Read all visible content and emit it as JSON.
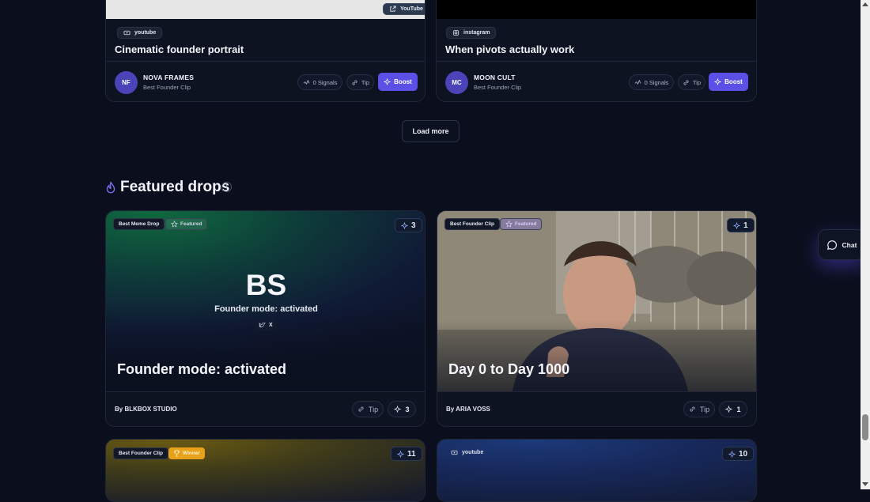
{
  "top_cards": [
    {
      "media_badge": "YouTube",
      "platform": "youtube",
      "title": "Cinematic founder portrait",
      "initials": "NF",
      "creator": "NOVA FRAMES",
      "category": "Best Founder Clip",
      "signals": "0 Signals",
      "tip": "Tip",
      "boost": "Boost"
    },
    {
      "platform": "instagram",
      "title": "When pivots actually work",
      "initials": "MC",
      "creator": "MOON CULT",
      "category": "Best Founder Clip",
      "signals": "0 Signals",
      "tip": "Tip",
      "boost": "Boost"
    }
  ],
  "load_more": "Load more",
  "section": {
    "title": "Featured drops",
    "info": "i"
  },
  "featured": [
    {
      "category": "Best Meme Drop",
      "featured": "Featured",
      "count": "3",
      "big_initials": "BS",
      "caption": "Founder mode: activated",
      "network": "X",
      "title": "Founder mode: activated",
      "by_prefix": "By",
      "author": "BLKBOX STUDIO",
      "tip": "Tip",
      "boost_count": "3"
    },
    {
      "category": "Best Founder Clip",
      "featured": "Featured",
      "count": "1",
      "title": "Day 0 to Day 1000",
      "by_prefix": "By",
      "author": "ARIA VOSS",
      "tip": "Tip",
      "boost_count": "1"
    }
  ],
  "bottom_cards": [
    {
      "category": "Best Founder Clip",
      "status": "Winner",
      "count": "11"
    },
    {
      "platform": "youtube",
      "count": "10"
    }
  ],
  "chat": {
    "label": "Chat"
  },
  "colors": {
    "accent": "#5b4fe6",
    "winner": "#e7a11a",
    "background": "#0b0f1d"
  }
}
